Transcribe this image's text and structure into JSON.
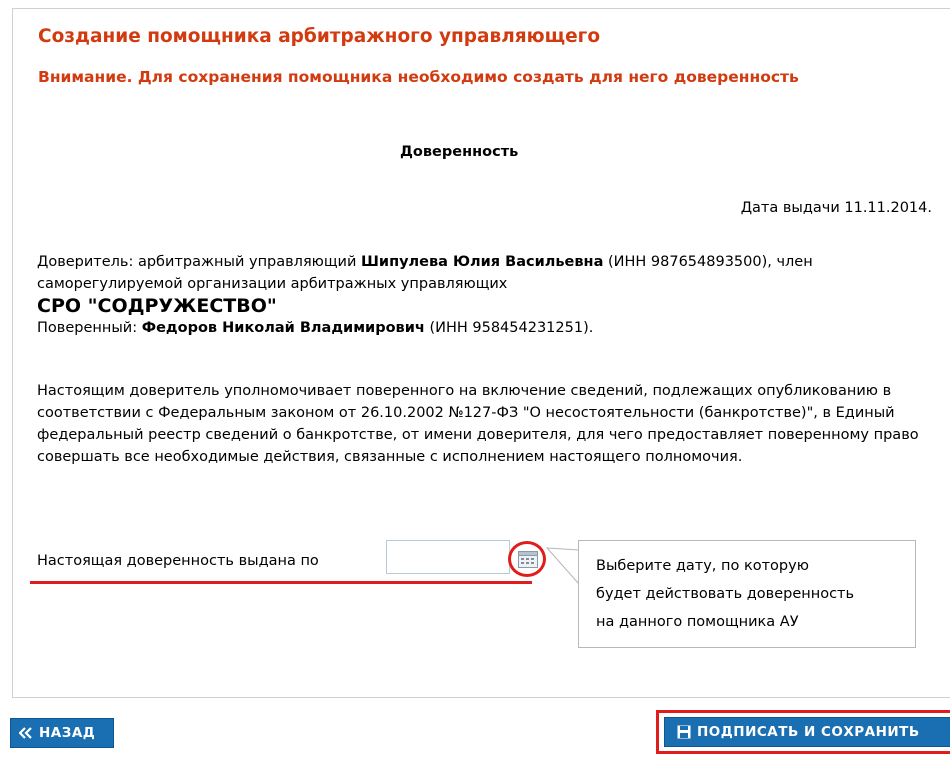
{
  "page": {
    "title": "Создание помощника арбитражного управляющего",
    "warning": "Внимание. Для сохранения помощника необходимо создать для него доверенность"
  },
  "document": {
    "heading": "Доверенность",
    "issue_date_label": "Дата выдачи 11.11.2014.",
    "principal_prefix": "Доверитель: арбитражный управляющий ",
    "principal_name": "Шипулева Юлия Васильевна",
    "principal_inn_text": " (ИНН 987654893500), член саморегулируемой организации арбитражных управляющих",
    "sro_name": "СРО \"СОДРУЖЕСТВО\"",
    "attorney_prefix": "Поверенный: ",
    "attorney_name": "Федоров Николай Владимирович",
    "attorney_inn_text": " (ИНН 958454231251).",
    "main_text": "Настоящим доверитель уполномочивает поверенного на включение сведений, подлежащих опубликованию в соответствии с Федеральным законом от 26.10.2002 №127-ФЗ \"О несостоятельности (банкротстве)\", в Единый федеральный реестр сведений о банкротстве, от имени доверителя, для чего предоставляет поверенному право совершать все необходимые действия, связанные с исполнением настоящего полномочия.",
    "valid_until_label": "Настоящая доверенность выдана по",
    "valid_until_value": ""
  },
  "tooltip": {
    "line1": "Выберите дату, по которую",
    "line2": "будет действовать доверенность",
    "line3": "на данного помощника АУ"
  },
  "buttons": {
    "back": "НАЗАД",
    "save": "ПОДПИСАТЬ И СОХРАНИТЬ"
  },
  "icons": {
    "back": "double-chevron-left-icon",
    "save": "floppy-disk-icon",
    "calendar": "calendar-icon"
  },
  "colors": {
    "heading_red": "#d23a10",
    "button_blue": "#1a6fb2",
    "highlight_red": "#e01c1c"
  }
}
